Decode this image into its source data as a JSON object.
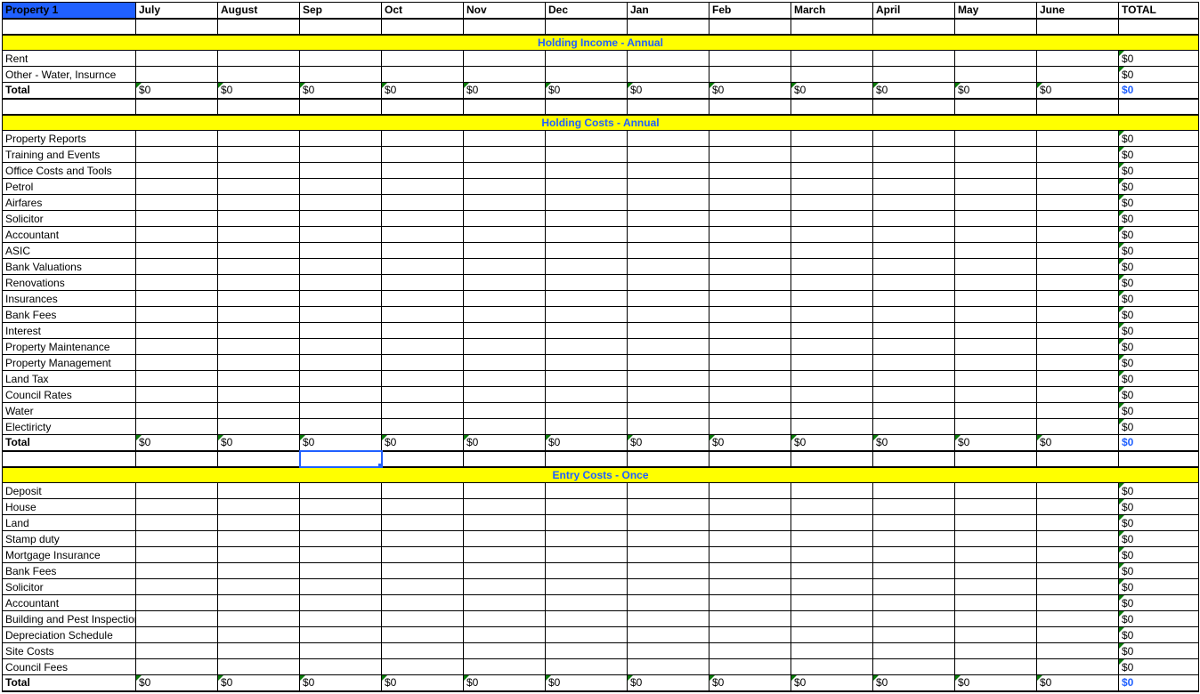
{
  "header": {
    "property": "Property 1",
    "months": [
      "July",
      "August",
      "Sep",
      "Oct",
      "Nov",
      "Dec",
      "Jan",
      "Feb",
      "March",
      "April",
      "May",
      "June"
    ],
    "total": "TOTAL"
  },
  "selected": {
    "section": 1,
    "rowIndex": 19,
    "col": 3
  },
  "sections": [
    {
      "title": "Holding Income - Annual",
      "rows": [
        {
          "label": "Rent",
          "months": [
            "",
            "",
            "",
            "",
            "",
            "",
            "",
            "",
            "",
            "",
            "",
            ""
          ],
          "total": "$0",
          "flag": true
        },
        {
          "label": "Other - Water, Insurnce",
          "months": [
            "",
            "",
            "",
            "",
            "",
            "",
            "",
            "",
            "",
            "",
            "",
            ""
          ],
          "total": "$0",
          "flag": true
        }
      ],
      "total": {
        "label": "Total",
        "months": [
          "$0",
          "$0",
          "$0",
          "$0",
          "$0",
          "$0",
          "$0",
          "$0",
          "$0",
          "$0",
          "$0",
          "$0"
        ],
        "total": "$0",
        "flag": true
      }
    },
    {
      "title": "Holding Costs - Annual",
      "rows": [
        {
          "label": "Property Reports",
          "months": [
            "",
            "",
            "",
            "",
            "",
            "",
            "",
            "",
            "",
            "",
            "",
            ""
          ],
          "total": "$0",
          "flag": true
        },
        {
          "label": "Training and Events",
          "months": [
            "",
            "",
            "",
            "",
            "",
            "",
            "",
            "",
            "",
            "",
            "",
            ""
          ],
          "total": "$0",
          "flag": true
        },
        {
          "label": "Office Costs and Tools",
          "months": [
            "",
            "",
            "",
            "",
            "",
            "",
            "",
            "",
            "",
            "",
            "",
            ""
          ],
          "total": "$0",
          "flag": true
        },
        {
          "label": "Petrol",
          "months": [
            "",
            "",
            "",
            "",
            "",
            "",
            "",
            "",
            "",
            "",
            "",
            ""
          ],
          "total": "$0",
          "flag": true
        },
        {
          "label": "Airfares",
          "months": [
            "",
            "",
            "",
            "",
            "",
            "",
            "",
            "",
            "",
            "",
            "",
            ""
          ],
          "total": "$0",
          "flag": true
        },
        {
          "label": "Solicitor",
          "months": [
            "",
            "",
            "",
            "",
            "",
            "",
            "",
            "",
            "",
            "",
            "",
            ""
          ],
          "total": "$0",
          "flag": true
        },
        {
          "label": "Accountant",
          "months": [
            "",
            "",
            "",
            "",
            "",
            "",
            "",
            "",
            "",
            "",
            "",
            ""
          ],
          "total": "$0",
          "flag": true
        },
        {
          "label": "ASIC",
          "months": [
            "",
            "",
            "",
            "",
            "",
            "",
            "",
            "",
            "",
            "",
            "",
            ""
          ],
          "total": "$0",
          "flag": true
        },
        {
          "label": "Bank Valuations",
          "months": [
            "",
            "",
            "",
            "",
            "",
            "",
            "",
            "",
            "",
            "",
            "",
            ""
          ],
          "total": "$0",
          "flag": true
        },
        {
          "label": "Renovations",
          "months": [
            "",
            "",
            "",
            "",
            "",
            "",
            "",
            "",
            "",
            "",
            "",
            ""
          ],
          "total": "$0",
          "flag": true
        },
        {
          "label": "Insurances",
          "months": [
            "",
            "",
            "",
            "",
            "",
            "",
            "",
            "",
            "",
            "",
            "",
            ""
          ],
          "total": "$0",
          "flag": true
        },
        {
          "label": "Bank Fees",
          "months": [
            "",
            "",
            "",
            "",
            "",
            "",
            "",
            "",
            "",
            "",
            "",
            ""
          ],
          "total": "$0",
          "flag": true
        },
        {
          "label": "Interest",
          "months": [
            "",
            "",
            "",
            "",
            "",
            "",
            "",
            "",
            "",
            "",
            "",
            ""
          ],
          "total": "$0",
          "flag": true
        },
        {
          "label": "Property Maintenance",
          "months": [
            "",
            "",
            "",
            "",
            "",
            "",
            "",
            "",
            "",
            "",
            "",
            ""
          ],
          "total": "$0",
          "flag": true
        },
        {
          "label": "Property Management",
          "months": [
            "",
            "",
            "",
            "",
            "",
            "",
            "",
            "",
            "",
            "",
            "",
            ""
          ],
          "total": "$0",
          "flag": true
        },
        {
          "label": "Land Tax",
          "months": [
            "",
            "",
            "",
            "",
            "",
            "",
            "",
            "",
            "",
            "",
            "",
            ""
          ],
          "total": "$0",
          "flag": true
        },
        {
          "label": "Council Rates",
          "months": [
            "",
            "",
            "",
            "",
            "",
            "",
            "",
            "",
            "",
            "",
            "",
            ""
          ],
          "total": "$0",
          "flag": true
        },
        {
          "label": "Water",
          "months": [
            "",
            "",
            "",
            "",
            "",
            "",
            "",
            "",
            "",
            "",
            "",
            ""
          ],
          "total": "$0",
          "flag": true
        },
        {
          "label": "Electiricty",
          "months": [
            "",
            "",
            "",
            "",
            "",
            "",
            "",
            "",
            "",
            "",
            "",
            ""
          ],
          "total": "$0",
          "flag": true
        }
      ],
      "total": {
        "label": "Total",
        "months": [
          "$0",
          "$0",
          "$0",
          "$0",
          "$0",
          "$0",
          "$0",
          "$0",
          "$0",
          "$0",
          "$0",
          "$0"
        ],
        "total": "$0",
        "flag": true
      }
    },
    {
      "title": "Entry Costs - Once",
      "rows": [
        {
          "label": "Deposit",
          "months": [
            "",
            "",
            "",
            "",
            "",
            "",
            "",
            "",
            "",
            "",
            "",
            ""
          ],
          "total": "$0",
          "flag": true
        },
        {
          "label": "House",
          "months": [
            "",
            "",
            "",
            "",
            "",
            "",
            "",
            "",
            "",
            "",
            "",
            ""
          ],
          "total": "$0",
          "flag": true
        },
        {
          "label": "Land",
          "months": [
            "",
            "",
            "",
            "",
            "",
            "",
            "",
            "",
            "",
            "",
            "",
            ""
          ],
          "total": "$0",
          "flag": true
        },
        {
          "label": "Stamp duty",
          "months": [
            "",
            "",
            "",
            "",
            "",
            "",
            "",
            "",
            "",
            "",
            "",
            ""
          ],
          "total": "$0",
          "flag": true
        },
        {
          "label": "Mortgage Insurance",
          "months": [
            "",
            "",
            "",
            "",
            "",
            "",
            "",
            "",
            "",
            "",
            "",
            ""
          ],
          "total": "$0",
          "flag": true
        },
        {
          "label": "Bank Fees",
          "months": [
            "",
            "",
            "",
            "",
            "",
            "",
            "",
            "",
            "",
            "",
            "",
            ""
          ],
          "total": "$0",
          "flag": true
        },
        {
          "label": "Solicitor",
          "months": [
            "",
            "",
            "",
            "",
            "",
            "",
            "",
            "",
            "",
            "",
            "",
            ""
          ],
          "total": "$0",
          "flag": true
        },
        {
          "label": "Accountant",
          "months": [
            "",
            "",
            "",
            "",
            "",
            "",
            "",
            "",
            "",
            "",
            "",
            ""
          ],
          "total": "$0",
          "flag": true
        },
        {
          "label": "Building and Pest Inspection",
          "months": [
            "",
            "",
            "",
            "",
            "",
            "",
            "",
            "",
            "",
            "",
            "",
            ""
          ],
          "total": "$0",
          "flag": true
        },
        {
          "label": "Depreciation Schedule",
          "months": [
            "",
            "",
            "",
            "",
            "",
            "",
            "",
            "",
            "",
            "",
            "",
            ""
          ],
          "total": "$0",
          "flag": true
        },
        {
          "label": "Site Costs",
          "months": [
            "",
            "",
            "",
            "",
            "",
            "",
            "",
            "",
            "",
            "",
            "",
            ""
          ],
          "total": "$0",
          "flag": true
        },
        {
          "label": "Council Fees",
          "months": [
            "",
            "",
            "",
            "",
            "",
            "",
            "",
            "",
            "",
            "",
            "",
            ""
          ],
          "total": "$0",
          "flag": true
        }
      ],
      "total": {
        "label": "Total",
        "months": [
          "$0",
          "$0",
          "$0",
          "$0",
          "$0",
          "$0",
          "$0",
          "$0",
          "$0",
          "$0",
          "$0",
          "$0"
        ],
        "total": "$0",
        "flag": true
      }
    }
  ]
}
